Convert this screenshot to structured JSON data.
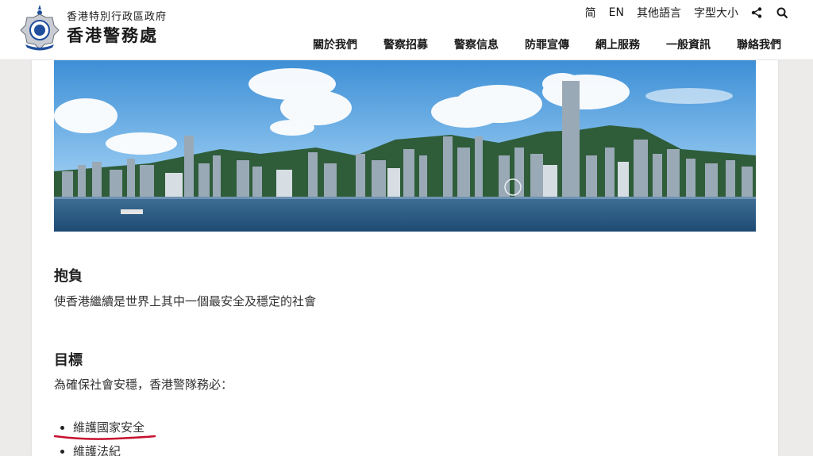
{
  "header": {
    "org_subtitle": "香港特別行政區政府",
    "org_title": "香港警務處",
    "utility": {
      "simplified": "简",
      "english": "EN",
      "other_languages": "其他語言",
      "font_size": "字型大小",
      "share_icon": "share-icon",
      "search_icon": "search-icon"
    },
    "nav": [
      {
        "label": "關於我們"
      },
      {
        "label": "警察招募"
      },
      {
        "label": "警察信息"
      },
      {
        "label": "防罪宣傳"
      },
      {
        "label": "網上服務"
      },
      {
        "label": "一般資訊"
      },
      {
        "label": "聯絡我們"
      }
    ]
  },
  "content": {
    "mission_title": "抱負",
    "mission_text": "使香港繼續是世界上其中一個最安全及穩定的社會",
    "goals_title": "目標",
    "goals_intro": "為確保社會安穩，香港警隊務必：",
    "goals": [
      {
        "text": "維護國家安全"
      },
      {
        "text": "維護法紀"
      }
    ]
  },
  "colors": {
    "accent_underline": "#c8102e",
    "emblem_blue": "#1f4e9c"
  }
}
